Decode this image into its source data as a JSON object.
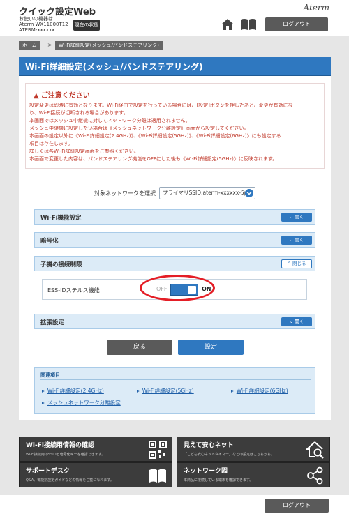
{
  "header": {
    "title": "クイック設定Web",
    "device_line1": "お使いの機器は",
    "device_line2": "Aterm WX11000T12",
    "device_line3": "ATERM-xxxxxx",
    "status_button": "現在の状態",
    "brand": "Aterm",
    "logout": "ログアウト"
  },
  "breadcrumb": {
    "home": "ホーム",
    "sep": ">",
    "current": "Wi-Fi詳細設定(メッシュ/バンドステアリング)"
  },
  "page": {
    "title": "Wi-Fi詳細設定(メッシュ/バンドステアリング)"
  },
  "notice": {
    "title": "ご注意ください",
    "lines": [
      "設定変更は即時に有効となります。Wi-Fi経由で設定を行っている場合には、[設定]ボタンを押したあと、変更が有効にな",
      "り、Wi-Fi接続が切断される場合があります。",
      "本画面ではメッシュ中継機に対してネットワーク分離は適用されません。",
      "メッシュ中継機に設定したい場合は《メッシュネットワーク分離設定》画面から設定してください。",
      "本画面の設定以外に《Wi-Fi詳細設定(2.4GHz)》、《Wi-Fi詳細設定(5GHz)》、《Wi-Fi詳細設定(6GHz)》にも設定する",
      "項目は存在します。",
      "詳しくは各Wi-Fi詳細設定画面をご参照ください。",
      "本画面で変更した内容は、バンドステアリング機能をOFFにした後も《Wi-Fi詳細設定(5GHz)》に反映されます。"
    ]
  },
  "target": {
    "label": "対象ネットワークを選択",
    "value": "プライマリSSID:aterm-xxxxxx-5p"
  },
  "sections": {
    "wifi_func": {
      "title": "Wi-Fi機能設定",
      "toggle": "開く"
    },
    "encryption": {
      "title": "暗号化",
      "toggle": "開く"
    },
    "child_limit": {
      "title": "子機の接続制限",
      "toggle": "閉じる"
    },
    "extended": {
      "title": "拡張設定",
      "toggle": "開く"
    }
  },
  "ess_stealth": {
    "label": "ESS-IDステルス機能",
    "off_label": "OFF",
    "on_label": "ON",
    "state": "on"
  },
  "actions": {
    "back": "戻る",
    "apply": "設定"
  },
  "related": {
    "title": "関連項目",
    "links": [
      "Wi-Fi詳細設定(2.4GHz)",
      "Wi-Fi詳細設定(5GHz)",
      "Wi-Fi詳細設定(6GHz)",
      "メッシュネットワーク分離設定"
    ]
  },
  "tiles": [
    {
      "title": "Wi-Fi接続用情報の確認",
      "desc": "Wi-Fi接続用のSSIDと暗号化キーを確認できます。",
      "icon": "qr-code-icon"
    },
    {
      "title": "見えて安心ネット",
      "desc": "「こども安心ネットタイマー」などの設定はこちらから。",
      "icon": "home-search-icon"
    },
    {
      "title": "サポートデスク",
      "desc": "Q&A、機能別設定ガイドなどの情報をご覧になれます。",
      "icon": "book-icon"
    },
    {
      "title": "ネットワーク図",
      "desc": "本商品に接続している端末を確認できます。",
      "icon": "network-icon"
    }
  ],
  "footer": {
    "logout": "ログアウト"
  },
  "colors": {
    "accent": "#2f78c0",
    "notice_text": "#c0392b",
    "section_bg": "#dcebf7",
    "dark_button": "#5a5a5a"
  }
}
